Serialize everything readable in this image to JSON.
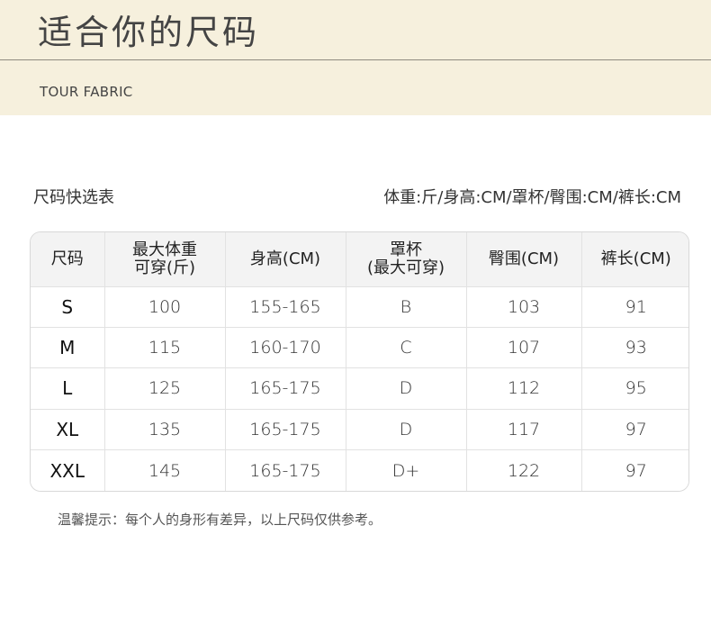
{
  "banner": {
    "title": "适合你的尺码",
    "subtitle": "TOUR FABRIC"
  },
  "section": {
    "title": "尺码快选表",
    "units": "体重:斤/身高:CM/罩杯/臀围:CM/裤长:CM"
  },
  "table": {
    "headers": [
      [
        "尺码"
      ],
      [
        "最大体重",
        "可穿(斤)"
      ],
      [
        "身高(CM)"
      ],
      [
        "罩杯",
        "(最大可穿)"
      ],
      [
        "臀围(CM)"
      ],
      [
        "裤长(CM)"
      ]
    ],
    "rows": [
      [
        "S",
        "100",
        "155-165",
        "B",
        "103",
        "91"
      ],
      [
        "M",
        "115",
        "160-170",
        "C",
        "107",
        "93"
      ],
      [
        "L",
        "125",
        "165-175",
        "D",
        "112",
        "95"
      ],
      [
        "XL",
        "135",
        "165-175",
        "D",
        "117",
        "97"
      ],
      [
        "XXL",
        "145",
        "165-175",
        "D+",
        "122",
        "97"
      ]
    ]
  },
  "tip": "温馨提示：每个人的身形有差异，以上尺码仅供参考。"
}
